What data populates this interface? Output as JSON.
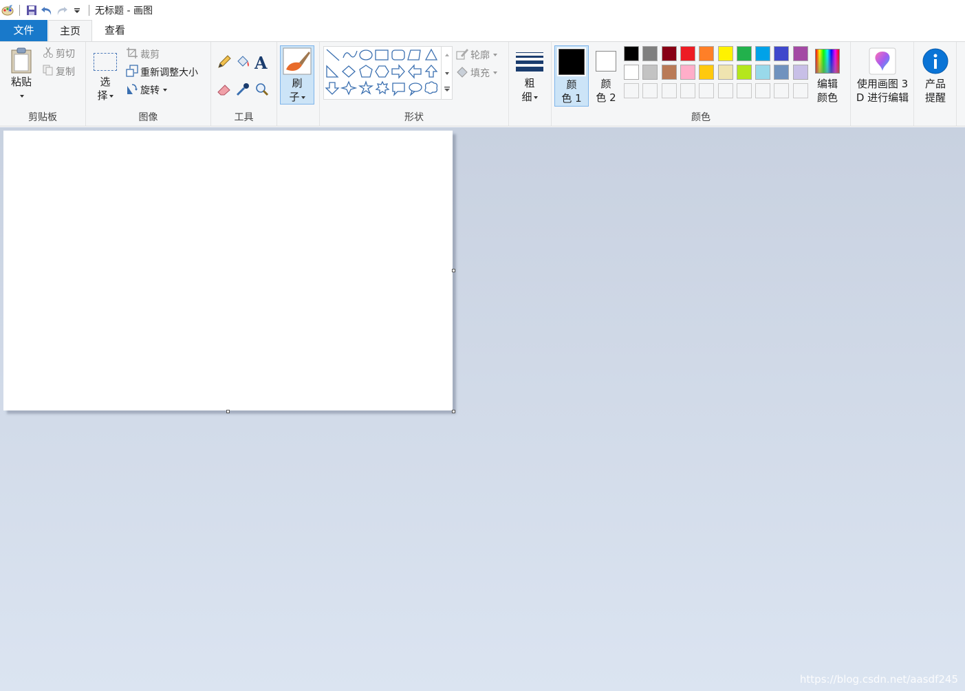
{
  "title_bar": {
    "title": "无标题 - 画图",
    "quick_access": [
      "app-icon",
      "save-icon",
      "undo-icon",
      "redo-icon",
      "customize-icon"
    ]
  },
  "tabs": [
    {
      "label": "文件"
    },
    {
      "label": "主页"
    },
    {
      "label": "查看"
    }
  ],
  "ribbon": {
    "clipboard": {
      "label": "剪贴板",
      "paste": "粘贴",
      "cut": "剪切",
      "copy": "复制"
    },
    "image": {
      "label": "图像",
      "select_1": "选",
      "select_2": "择",
      "crop": "裁剪",
      "resize": "重新调整大小",
      "rotate": "旋转"
    },
    "tools": {
      "label": "工具"
    },
    "brushes": {
      "line1": "刷",
      "line2": "子"
    },
    "shapes": {
      "label": "形状",
      "outline": "轮廓",
      "fill": "填充"
    },
    "size": {
      "line1": "粗",
      "line2": "细"
    },
    "colors": {
      "label": "颜色",
      "color1_l1": "颜",
      "color1_l2": "色 1",
      "color2_l1": "颜",
      "color2_l2": "色 2",
      "edit_l1": "编辑",
      "edit_l2": "颜色",
      "row1": [
        "#000000",
        "#7f7f7f",
        "#880015",
        "#ed1c24",
        "#ff7f27",
        "#fff200",
        "#22b14c",
        "#00a2e8",
        "#3f48cc",
        "#a349a4"
      ],
      "row2": [
        "#ffffff",
        "#c3c3c3",
        "#b97a57",
        "#ffaec9",
        "#ffc90e",
        "#efe4b0",
        "#b5e61d",
        "#99d9ea",
        "#7092be",
        "#c8bfe7"
      ]
    },
    "paint3d": {
      "line1": "使用画图 3",
      "line2": "D 进行编辑"
    },
    "notice": {
      "line1": "产品",
      "line2": "提醒"
    }
  },
  "watermark": "https://blog.csdn.net/aasdf245"
}
